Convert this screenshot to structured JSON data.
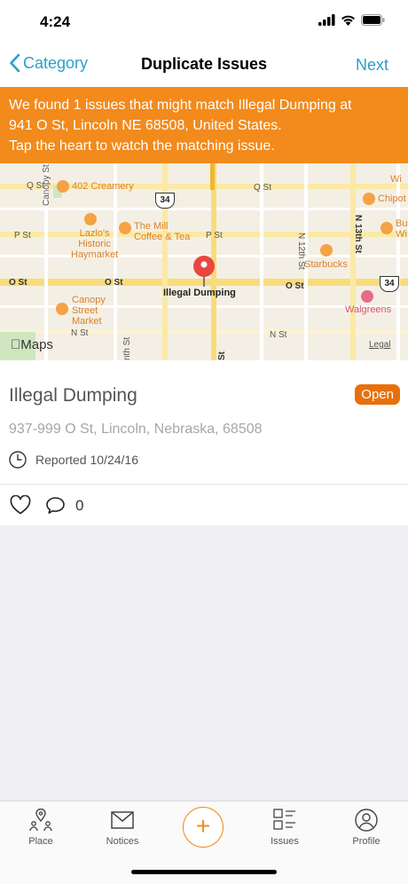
{
  "status_bar": {
    "time": "4:24"
  },
  "nav": {
    "back_label": "Category",
    "title": "Duplicate Issues",
    "next_label": "Next"
  },
  "banner": {
    "line1": "We found 1 issues that might match Illegal Dumping at",
    "line2": "941 O St, Lincoln NE 68508, United States.",
    "line3": "Tap the heart to watch the matching issue."
  },
  "map": {
    "streets": {
      "q_st_left": "Q St",
      "q_st_right": "Q St",
      "p_st_left": "P St",
      "p_st_right": "P St",
      "o_st_left": "O St",
      "o_st_mid": "O St",
      "o_st_right": "O St",
      "n_st_left": "N St",
      "n_st_right": "N St",
      "canopy_st": "Canopy St",
      "n_12th_st": "N 12th St",
      "n_13th_st": "N 13th St",
      "nth_st": "nth St",
      "st_bottom": "St"
    },
    "pois": {
      "creamery": "402 Creamery",
      "the_mill": [
        "The Mill",
        "Coffee & Tea"
      ],
      "haymarket": [
        "Lazlo's",
        "Historic",
        "Haymarket"
      ],
      "canopy_market": [
        "Canopy",
        "Street",
        "Market"
      ],
      "starbucks": "Starbucks",
      "walgreens": "Walgreens",
      "chipotle": "Chipot",
      "bu": [
        "Bu",
        "Wi"
      ]
    },
    "route_34": "34",
    "pin_label": "Illegal Dumping",
    "logo_text": "Maps",
    "legal": "Legal"
  },
  "issue": {
    "title": "Illegal Dumping",
    "status": "Open",
    "address": "937-999 O St, Lincoln, Nebraska, 68508",
    "reported": "Reported 10/24/16",
    "comment_count": "0"
  },
  "tabs": {
    "place": "Place",
    "notices": "Notices",
    "add": "+",
    "issues": "Issues",
    "profile": "Profile"
  },
  "colors": {
    "accent_blue": "#2aa0c8",
    "banner_orange": "#f28a1c",
    "badge_orange": "#e8700c",
    "pin_red": "#e8473f"
  }
}
